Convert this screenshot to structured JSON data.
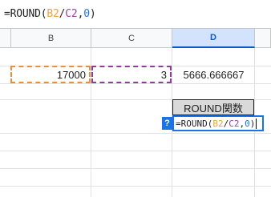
{
  "formula_bar": {
    "prefix": "=ROUND(",
    "ref1": "B2",
    "sep1": "/",
    "ref2": "C2",
    "sep2": ",",
    "digits": "0",
    "suffix": ")"
  },
  "columns": [
    {
      "label": "B",
      "selected": false
    },
    {
      "label": "C",
      "selected": false
    },
    {
      "label": "D",
      "selected": true
    }
  ],
  "cells": {
    "b2": "17000",
    "c2": "3",
    "d2": "5666.666667"
  },
  "label_cell": "ROUND関数",
  "help_badge": "?",
  "editor": {
    "prefix": "=ROUND(",
    "ref1": "B2",
    "sep1": "/",
    "ref2": "C2",
    "sep2": ",",
    "digits": "0",
    "suffix": ")"
  },
  "colors": {
    "ref_b": "#e8a33a",
    "ref_c": "#9b3ea1",
    "number": "#1a73e8",
    "selection": "#1a73e8"
  }
}
